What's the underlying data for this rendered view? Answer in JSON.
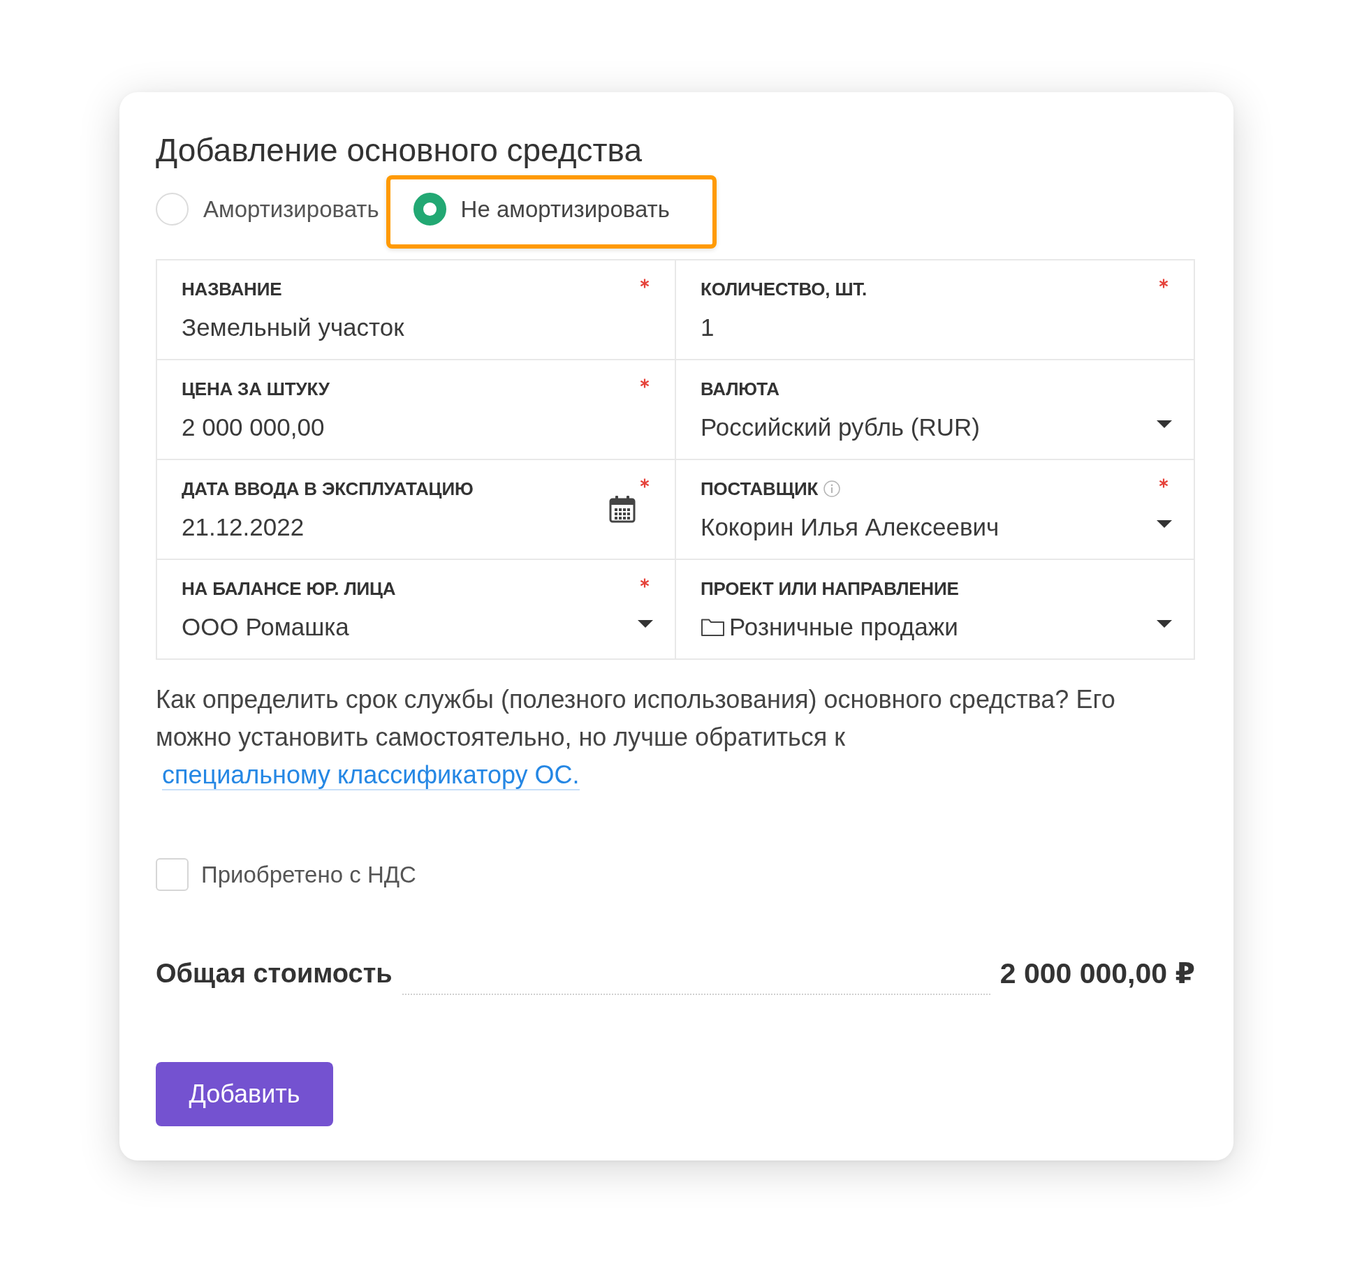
{
  "dialog": {
    "title": "Добавление основного средства"
  },
  "depreciation_options": [
    {
      "label": "Амортизировать",
      "selected": false,
      "highlighted": false
    },
    {
      "label": "Не амортизировать",
      "selected": true,
      "highlighted": true
    }
  ],
  "fields": [
    {
      "kind": "text",
      "label": "НАЗВАНИЕ",
      "value": "Земельный участок",
      "required": true
    },
    {
      "kind": "text",
      "label": "КОЛИЧЕСТВО, ШТ.",
      "value": "1",
      "required": true
    },
    {
      "kind": "text",
      "label": "ЦЕНА ЗА ШТУКУ",
      "value": "2 000 000,00",
      "required": true
    },
    {
      "kind": "select",
      "label": "ВАЛЮТА",
      "value": "Российский рубль (RUR)",
      "required": false
    },
    {
      "kind": "date",
      "label": "ДАТА ВВОДА В ЭКСПЛУАТАЦИЮ",
      "value": "21.12.2022",
      "required": true
    },
    {
      "kind": "select",
      "label": "ПОСТАВЩИК",
      "value": "Кокорин Илья Алексеевич",
      "required": true,
      "info": true
    },
    {
      "kind": "select",
      "label": "НА БАЛАНСЕ ЮР. ЛИЦА",
      "value": "ООО Ромашка",
      "required": true
    },
    {
      "kind": "tree_select",
      "label": "ПРОЕКТ ИЛИ НАПРАВЛЕНИЕ",
      "value": "Розничные продажи",
      "required": false
    }
  ],
  "help": {
    "text": "Как определить срок службы (полезного использования) основного средства? Его можно установить самостоятельно, но лучше обратиться к",
    "link": "специальному классификатору ОС."
  },
  "vat_checkbox": {
    "label": "Приобретено с НДС",
    "checked": false
  },
  "total": {
    "label": "Общая стоимость",
    "value": "2 000 000,00 ₽"
  },
  "submit_button": {
    "label": "Добавить"
  }
}
